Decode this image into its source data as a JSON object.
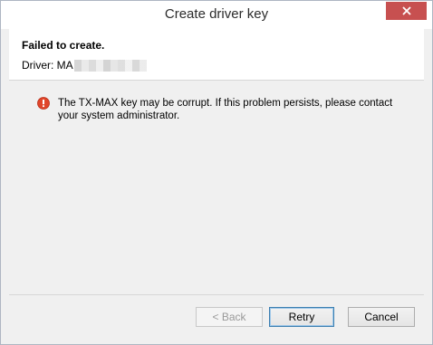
{
  "window": {
    "title": "Create driver key",
    "close_icon": "close-icon"
  },
  "header": {
    "title": "Failed to create.",
    "driver_label": "Driver: MA"
  },
  "message": {
    "icon": "error-icon",
    "text": "The TX-MAX key may be corrupt. If this problem persists, please contact your system administrator."
  },
  "buttons": {
    "back_label": "< Back",
    "retry_label": "Retry",
    "cancel_label": "Cancel"
  },
  "colors": {
    "close_button": "#c75050",
    "error_icon": "#e0452a",
    "default_button_border": "#3c7fb1"
  }
}
